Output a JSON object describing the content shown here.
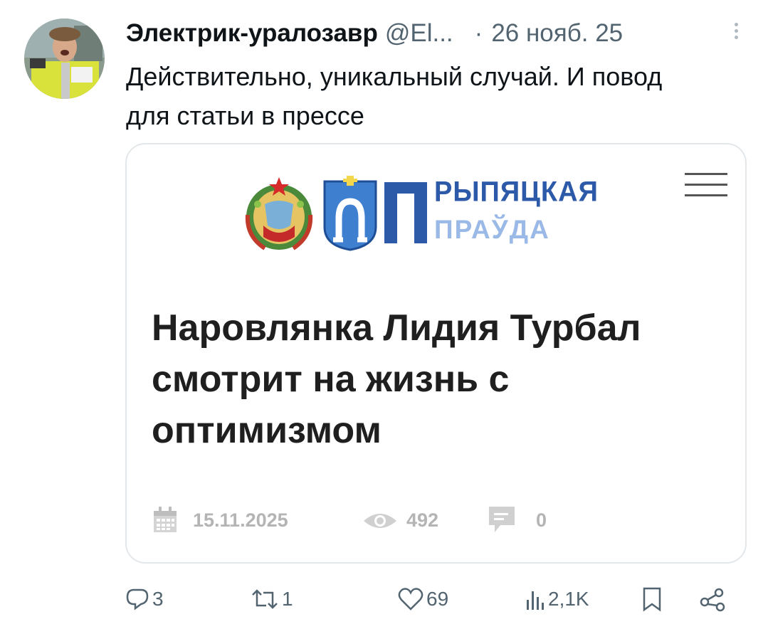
{
  "post": {
    "author_name": "Электрик-уралозавр",
    "author_handle": "@El...",
    "separator": "·",
    "date": "26 нояб. 25",
    "text": "Действительно, уникальный случай. И повод для статьи в прессе"
  },
  "card": {
    "logo_line1": "РЫПЯЦКАЯ",
    "logo_line2": "ПРАЎДА",
    "headline": "Наровлянка Лидия Турбал смотрит на жизнь с оптимизмом",
    "date": "15.11.2025",
    "views": "492",
    "comments": "0"
  },
  "actions": {
    "replies": "3",
    "reposts": "1",
    "likes": "69",
    "views": "2,1K"
  },
  "icons": {
    "card_date": "calendar-icon",
    "card_views": "eye-icon",
    "card_comments": "comment-icon",
    "reply": "reply-icon",
    "repost": "repost-icon",
    "like": "heart-icon",
    "views": "analytics-icon",
    "bookmark": "bookmark-icon",
    "share": "share-icon"
  },
  "colors": {
    "text": "#0f1419",
    "secondary": "#536471",
    "logo_blue": "#2d5aa8",
    "logo_light_blue": "#9ab9e6",
    "card_border": "#e3e7ea"
  }
}
